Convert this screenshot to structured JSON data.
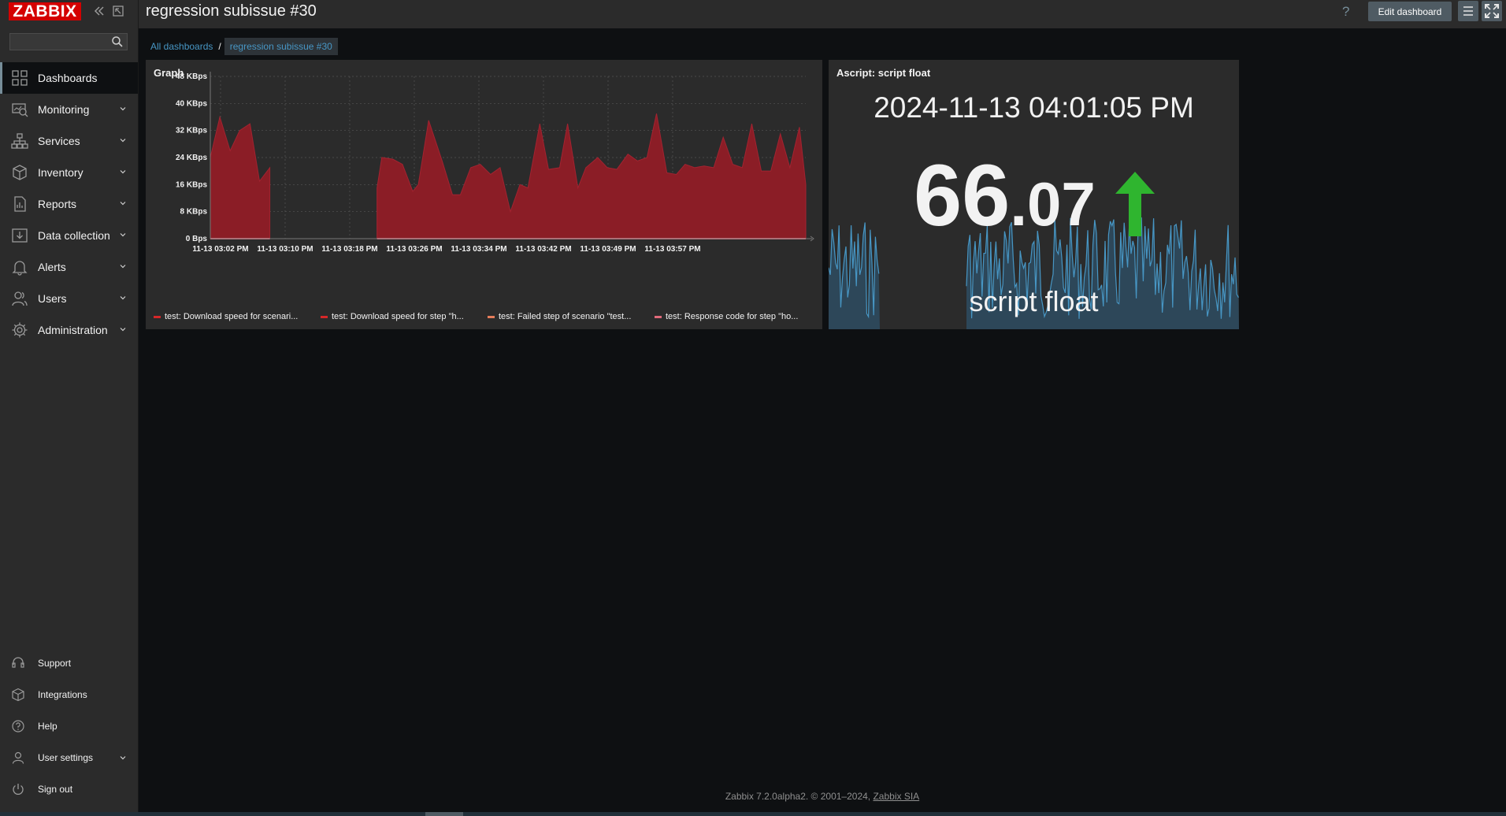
{
  "app": {
    "logo": "ZABBIX",
    "search_placeholder": ""
  },
  "header": {
    "title": "regression subissue #30",
    "help": "?",
    "edit_dashboard": "Edit dashboard"
  },
  "breadcrumb": {
    "root": "All dashboards",
    "separator": "/",
    "current": "regression subissue #30"
  },
  "sidebar": {
    "items": [
      {
        "label": "Dashboards",
        "icon": "dashboard-icon",
        "active": true
      },
      {
        "label": "Monitoring",
        "icon": "monitoring-icon"
      },
      {
        "label": "Services",
        "icon": "services-icon"
      },
      {
        "label": "Inventory",
        "icon": "inventory-icon"
      },
      {
        "label": "Reports",
        "icon": "reports-icon"
      },
      {
        "label": "Data collection",
        "icon": "data-collection-icon"
      },
      {
        "label": "Alerts",
        "icon": "alerts-icon"
      },
      {
        "label": "Users",
        "icon": "users-icon"
      },
      {
        "label": "Administration",
        "icon": "administration-icon"
      }
    ],
    "bottom": [
      {
        "label": "Support",
        "icon": "support-icon"
      },
      {
        "label": "Integrations",
        "icon": "integrations-icon"
      },
      {
        "label": "Help",
        "icon": "help-icon"
      },
      {
        "label": "User settings",
        "icon": "user-icon"
      },
      {
        "label": "Sign out",
        "icon": "power-icon"
      }
    ]
  },
  "graph_widget": {
    "title": "Graph",
    "legend": [
      {
        "label": "test: Download speed for scenari...",
        "color": "#d62728"
      },
      {
        "label": "test: Download speed for step \"h...",
        "color": "#d62728"
      },
      {
        "label": "test: Failed step of scenario \"test...",
        "color": "#e57c5a"
      },
      {
        "label": "test: Response code for step \"ho...",
        "color": "#e06a7a"
      }
    ]
  },
  "item_widget": {
    "title": "Ascript: script float",
    "time": "2024-11-13 04:01:05 PM",
    "value_int": "66",
    "value_dec": ".07",
    "description": "script float",
    "arrow_color": "#2fb52f",
    "sparkline_color": "#4796c4"
  },
  "chart_data": {
    "type": "area",
    "title": "Graph",
    "ylabel": "",
    "y_ticks": [
      "0 Bps",
      "8 KBps",
      "16 KBps",
      "24 KBps",
      "32 KBps",
      "40 KBps",
      "48 KBps"
    ],
    "ylim": [
      0,
      48
    ],
    "unit": "KBps",
    "x_ticks": [
      "11-13 03:02 PM",
      "11-13 03:10 PM",
      "11-13 03:18 PM",
      "11-13 03:26 PM",
      "11-13 03:34 PM",
      "11-13 03:42 PM",
      "11-13 03:49 PM",
      "11-13 03:57 PM"
    ],
    "xlim": [
      0,
      61
    ],
    "grid": true,
    "series": [
      {
        "name": "test: Download speed for scenari...",
        "color": "#8b1d26",
        "segments": [
          [
            [
              0.0,
              24
            ],
            [
              1.2,
              36
            ],
            [
              2.5,
              26
            ],
            [
              3.7,
              32
            ],
            [
              5.0,
              34
            ],
            [
              6.2,
              17
            ],
            [
              7.5,
              21
            ]
          ],
          [
            [
              21.0,
              15
            ],
            [
              21.6,
              24
            ],
            [
              23.0,
              23.5
            ],
            [
              24.2,
              22
            ],
            [
              25.5,
              14
            ],
            [
              26.2,
              16
            ],
            [
              27.5,
              35
            ],
            [
              29.2,
              23
            ],
            [
              30.5,
              13
            ],
            [
              31.5,
              13
            ],
            [
              32.8,
              21
            ],
            [
              34.0,
              22
            ],
            [
              35.3,
              19
            ],
            [
              36.5,
              21
            ],
            [
              37.8,
              8
            ],
            [
              39.0,
              16
            ],
            [
              40.0,
              15
            ],
            [
              41.5,
              34
            ],
            [
              42.6,
              20.5
            ],
            [
              44.0,
              21
            ],
            [
              45.0,
              34
            ],
            [
              46.3,
              15
            ],
            [
              47.3,
              21
            ],
            [
              48.8,
              24
            ],
            [
              50.0,
              21
            ],
            [
              51.2,
              20.5
            ],
            [
              52.6,
              25
            ],
            [
              53.8,
              23
            ],
            [
              55.0,
              24
            ],
            [
              56.2,
              37
            ],
            [
              57.5,
              19.5
            ],
            [
              58.7,
              19
            ],
            [
              59.8,
              22
            ],
            [
              61.0,
              21
            ]
          ]
        ]
      }
    ],
    "series_extra": [
      {
        "x": [
          61.0,
          62.2,
          63.4,
          64.6,
          65.8,
          67.0,
          68.2,
          69.4,
          70.6,
          71.8,
          73.0,
          74.2,
          75.0
        ],
        "y": [
          21,
          21.5,
          21,
          30,
          22,
          21,
          34,
          20,
          20,
          31,
          21,
          33,
          16
        ]
      }
    ]
  }
}
